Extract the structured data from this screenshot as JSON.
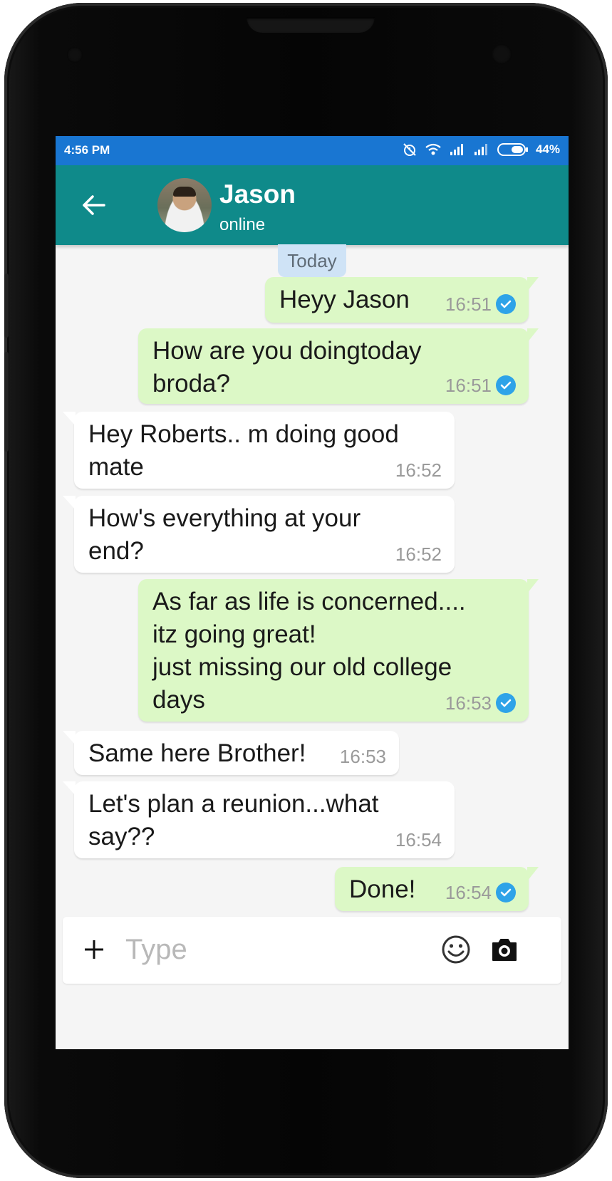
{
  "status_bar": {
    "time": "4:56 PM",
    "battery": "44%",
    "icons": [
      "alarm-off-icon",
      "wifi-icon",
      "signal-icon",
      "signal-icon",
      "battery-icon"
    ]
  },
  "header": {
    "back_icon": "arrow-left-icon",
    "contact_name": "Jason",
    "contact_status": "online"
  },
  "date_chip": "Today",
  "messages": [
    {
      "direction": "out",
      "text": "Heyy Jason",
      "time": "16:51",
      "read": true
    },
    {
      "direction": "out",
      "text": "How are you doingtoday\nbroda?",
      "time": "16:51",
      "read": true
    },
    {
      "direction": "in",
      "text": "Hey Roberts.. m doing good\nmate",
      "time": "16:52"
    },
    {
      "direction": "in",
      "text": "How's everything at your\nend?",
      "time": "16:52"
    },
    {
      "direction": "out",
      "text": "As far as life is concerned....\nitz going great!\njust missing our old college\ndays",
      "time": "16:53",
      "read": true
    },
    {
      "direction": "in",
      "text": "Same here Brother!",
      "time": "16:53"
    },
    {
      "direction": "in",
      "text": "Let's plan a reunion...what\nsay??",
      "time": "16:54"
    },
    {
      "direction": "out",
      "text": "Done!",
      "time": "16:54",
      "read": true
    }
  ],
  "composer": {
    "placeholder": "Type",
    "value": "",
    "icons": [
      "plus-icon",
      "emoji-icon",
      "camera-icon"
    ]
  },
  "colors": {
    "status_bar": "#1976d2",
    "app_bar": "#0f8a8a",
    "outgoing_bubble": "#dcf8c6",
    "incoming_bubble": "#ffffff",
    "chat_background": "#f5f5f5",
    "read_tick": "#2ea3e8"
  }
}
